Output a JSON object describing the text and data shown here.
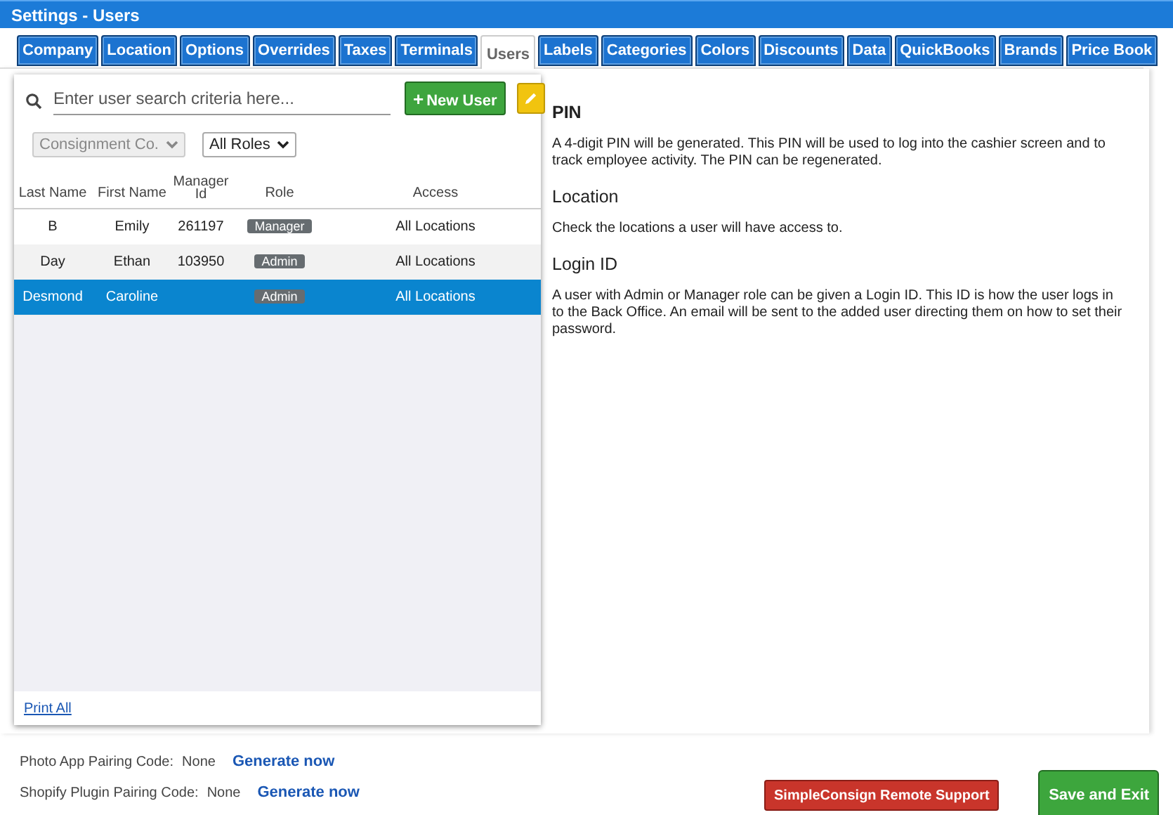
{
  "window": {
    "title": "Settings - Users"
  },
  "tabs": [
    {
      "label": "Company",
      "selected": false
    },
    {
      "label": "Location",
      "selected": false
    },
    {
      "label": "Options",
      "selected": false
    },
    {
      "label": "Overrides",
      "selected": false
    },
    {
      "label": "Taxes",
      "selected": false
    },
    {
      "label": "Terminals",
      "selected": false
    },
    {
      "label": "Users",
      "selected": true
    },
    {
      "label": "Labels",
      "selected": false
    },
    {
      "label": "Categories",
      "selected": false
    },
    {
      "label": "Colors",
      "selected": false
    },
    {
      "label": "Discounts",
      "selected": false
    },
    {
      "label": "Data",
      "selected": false
    },
    {
      "label": "QuickBooks",
      "selected": false
    },
    {
      "label": "Brands",
      "selected": false
    },
    {
      "label": "Price Book",
      "selected": false
    }
  ],
  "search": {
    "placeholder": "Enter user search criteria here..."
  },
  "new_user_button": {
    "icon": "+",
    "label": "New User"
  },
  "filters": [
    {
      "value": "Consignment Co.",
      "disabled": true
    },
    {
      "value": "All Roles",
      "disabled": false
    }
  ],
  "table": {
    "columns": [
      "Last Name",
      "First Name",
      "Manager Id",
      "Role",
      "Access"
    ],
    "rows": [
      {
        "last_name": "B",
        "first_name": "Emily",
        "manager_id": "261197",
        "role": "Manager",
        "access": "All Locations",
        "selected": false
      },
      {
        "last_name": "Day",
        "first_name": "Ethan",
        "manager_id": "103950",
        "role": "Admin",
        "access": "All Locations",
        "selected": false
      },
      {
        "last_name": "Desmond",
        "first_name": "Caroline",
        "manager_id": "",
        "role": "Admin",
        "access": "All Locations",
        "selected": true
      }
    ]
  },
  "print_link": "Print All",
  "help": [
    {
      "heading": "PIN",
      "text": "A 4-digit PIN will be generated. This PIN will be used to log into the cashier screen and to track employee activity. The PIN can be regenerated."
    },
    {
      "heading": "Location",
      "text": "Check the locations a user will have access to."
    },
    {
      "heading": "Login ID",
      "text": "A user with Admin or Manager role can be given a Login ID. This ID is how the user logs in to the Back Office. An email will be sent to the added user directing them on how to set their password."
    }
  ],
  "pairing": [
    {
      "label": "Photo App Pairing Code:",
      "value": "None",
      "action": "Generate now"
    },
    {
      "label": "Shopify Plugin Pairing Code:",
      "value": "None",
      "action": "Generate now"
    }
  ],
  "support_button": "SimpleConsign Remote Support",
  "save_button": "Save and Exit"
}
